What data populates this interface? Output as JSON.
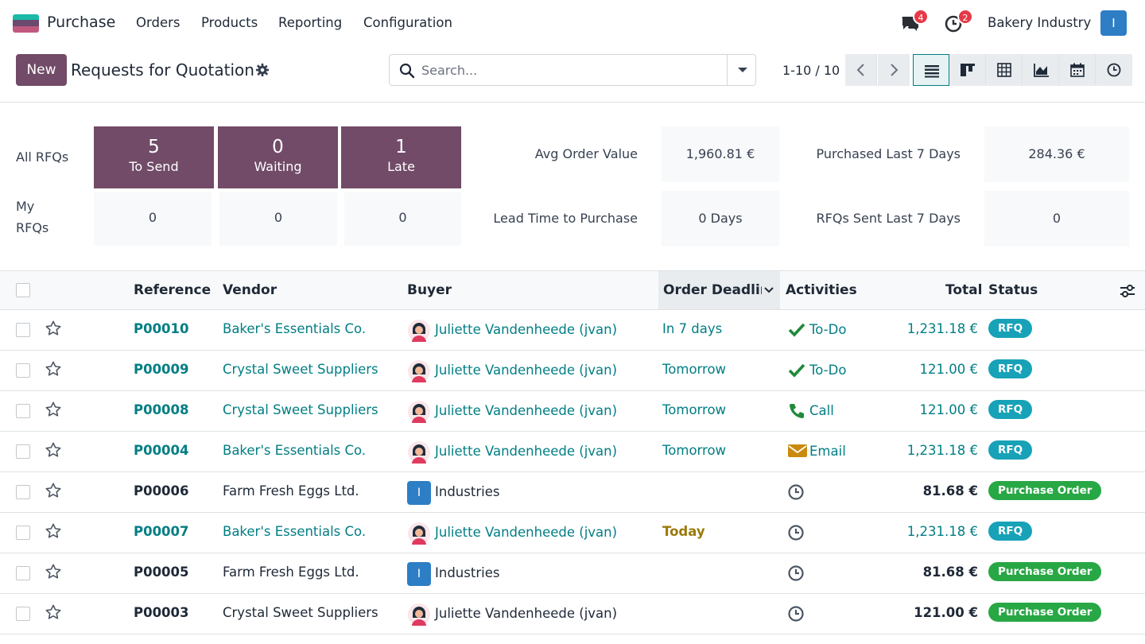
{
  "navbar": {
    "app_name": "Purchase",
    "menus": [
      "Orders",
      "Products",
      "Reporting",
      "Configuration"
    ],
    "messages_count": "4",
    "activities_count": "2",
    "company": "Bakery Industry",
    "user_initial": "I",
    "colors": {
      "accent": "#714b67",
      "link": "#017e84",
      "badge": "#e63946"
    }
  },
  "control_panel": {
    "new_label": "New",
    "title": "Requests for Quotation",
    "search_placeholder": "Search...",
    "pager": "1-10 / 10",
    "views": [
      "list-view-icon",
      "kanban-view-icon",
      "pivot-view-icon",
      "graph-view-icon",
      "calendar-view-icon",
      "activity-view-icon"
    ],
    "active_view": "list-view-icon"
  },
  "dashboard": {
    "all_label": "All RFQs",
    "my_label_1": "My",
    "my_label_2": "RFQs",
    "tiles": [
      {
        "value": "5",
        "label": "To Send"
      },
      {
        "value": "0",
        "label": "Waiting"
      },
      {
        "value": "1",
        "label": "Late"
      }
    ],
    "my_values": [
      "0",
      "0",
      "0"
    ],
    "stats": {
      "avg_order_value_label": "Avg Order Value",
      "avg_order_value": "1,960.81 €",
      "purchased_label": "Purchased Last 7 Days",
      "purchased": "284.36 €",
      "lead_time_label": "Lead Time to Purchase",
      "lead_time": "0 Days",
      "rfqs_sent_label": "RFQs Sent Last 7 Days",
      "rfqs_sent": "0"
    }
  },
  "list": {
    "columns": {
      "reference": "Reference",
      "vendor": "Vendor",
      "buyer": "Buyer",
      "deadline": "Order Deadline",
      "activities": "Activities",
      "total": "Total",
      "status": "Status"
    },
    "rows": [
      {
        "ref": "P00010",
        "vendor": "Baker's Essentials Co.",
        "buyer": "Juliette Vandenheede (jvan)",
        "deadline": "In 7 days",
        "activity": "To-Do",
        "total": "1,231.18 €",
        "status": "RFQ"
      },
      {
        "ref": "P00009",
        "vendor": "Crystal Sweet Suppliers",
        "buyer": "Juliette Vandenheede (jvan)",
        "deadline": "Tomorrow",
        "activity": "To-Do",
        "total": "121.00 €",
        "status": "RFQ"
      },
      {
        "ref": "P00008",
        "vendor": "Crystal Sweet Suppliers",
        "buyer": "Juliette Vandenheede (jvan)",
        "deadline": "Tomorrow",
        "activity": "Call",
        "total": "121.00 €",
        "status": "RFQ"
      },
      {
        "ref": "P00004",
        "vendor": "Baker's Essentials Co.",
        "buyer": "Juliette Vandenheede (jvan)",
        "deadline": "Tomorrow",
        "activity": "Email",
        "total": "1,231.18 €",
        "status": "RFQ"
      },
      {
        "ref": "P00006",
        "vendor": "Farm Fresh Eggs Ltd.",
        "buyer": "Industries",
        "buyer_initial": "I",
        "deadline": "",
        "activity": "",
        "total": "81.68 €",
        "status": "Purchase Order"
      },
      {
        "ref": "P00007",
        "vendor": "Baker's Essentials Co.",
        "buyer": "Juliette Vandenheede (jvan)",
        "deadline": "Today",
        "activity": "",
        "total": "1,231.18 €",
        "status": "RFQ"
      },
      {
        "ref": "P00005",
        "vendor": "Farm Fresh Eggs Ltd.",
        "buyer": "Industries",
        "buyer_initial": "I",
        "deadline": "",
        "activity": "",
        "total": "81.68 €",
        "status": "Purchase Order"
      },
      {
        "ref": "P00003",
        "vendor": "Crystal Sweet Suppliers",
        "buyer": "Juliette Vandenheede (jvan)",
        "deadline": "",
        "activity": "",
        "total": "121.00 €",
        "status": "Purchase Order"
      }
    ]
  }
}
